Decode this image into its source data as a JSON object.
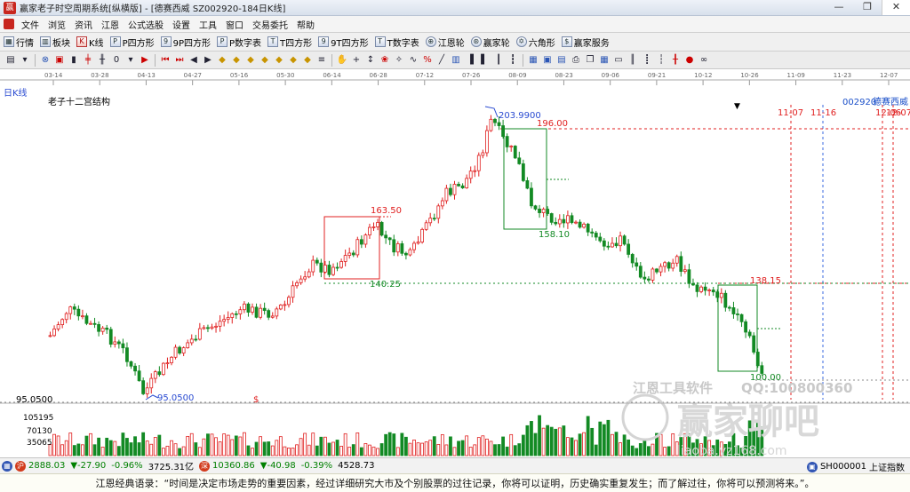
{
  "window": {
    "title": "赢家老子时空周期系统[纵横版] - [德赛西威  SZ002920-184日K线]",
    "minimize": "—",
    "maximize": "❐",
    "close": "✕"
  },
  "menu": [
    "文件",
    "浏览",
    "资讯",
    "江恩",
    "公式选股",
    "设置",
    "工具",
    "窗口",
    "交易委托",
    "帮助"
  ],
  "toolbar": [
    {
      "label": "行情",
      "icon": "grid-icon"
    },
    {
      "label": "板块",
      "icon": "sector-icon"
    },
    {
      "label": "K线",
      "icon": "kline-icon"
    },
    {
      "label": "P四方形",
      "icon": "p-square-icon"
    },
    {
      "label": "9P四方形",
      "icon": "9p-square-icon"
    },
    {
      "label": "P数字表",
      "icon": "p-table-icon"
    },
    {
      "label": "T四方形",
      "icon": "t-square-icon"
    },
    {
      "label": "9T四方形",
      "icon": "9t-square-icon"
    },
    {
      "label": "T数字表",
      "icon": "t-table-icon"
    },
    {
      "label": "江恩轮",
      "icon": "gann-wheel-icon"
    },
    {
      "label": "赢家轮",
      "icon": "winner-wheel-icon"
    },
    {
      "label": "六角形",
      "icon": "hexagon-icon"
    },
    {
      "label": "赢家服务",
      "icon": "service-icon"
    }
  ],
  "chart": {
    "period_label": "日K线",
    "structure_label": "老子十二宫结构",
    "stock_code": "002920",
    "stock_name": "德赛西威",
    "date_ticks": [
      "03-14",
      "03-28",
      "04-13",
      "04-27",
      "05-16",
      "05-30",
      "06-14",
      "06-28",
      "07-12",
      "07-26",
      "08-09",
      "08-23",
      "09-06",
      "09-21",
      "10-12",
      "10-26",
      "11-09",
      "11-23",
      "12-07"
    ],
    "future_dates": [
      "11-07",
      "11-16",
      "12-06",
      "12-07"
    ],
    "price_levels": {
      "high": "203.9900",
      "low": "95.0500",
      "axis_low": "95.0500",
      "box1_top": "163.50",
      "box1_bottom": "140.25",
      "box2_top": "196.00",
      "box2_bottom": "158.10",
      "box3_top": "138.15",
      "box3_bottom": "100.00"
    },
    "dollar_mark": "$",
    "volume_ticks": [
      "105195",
      "70130",
      "35065"
    ],
    "watermark_software": "江恩工具软件",
    "watermark_qq": "QQ:100800360",
    "watermark_brand": "赢家聊吧",
    "watermark_url": "liaoba.yz168.com",
    "colors": {
      "up": "#e02020",
      "down": "#138a24",
      "bg": "#ffffff"
    }
  },
  "status": {
    "sh_index": "2888.03",
    "sh_change": "▼-27.90",
    "sh_pct": "-0.96%",
    "sh_amount": "3725.31亿",
    "sz_index": "10360.86",
    "sz_change": "▼-40.98",
    "sz_pct": "-0.39%",
    "sz_amount": "4528.73",
    "right_code": "SH000001",
    "right_name": "上证指数"
  },
  "quote": "江恩经典语录：“时间是决定市场走势的重要因素，经过详细研究大市及个别股票的过往记录，你将可以证明，历史确实重复发生；而了解过往，你将可以预测将来。”。"
}
